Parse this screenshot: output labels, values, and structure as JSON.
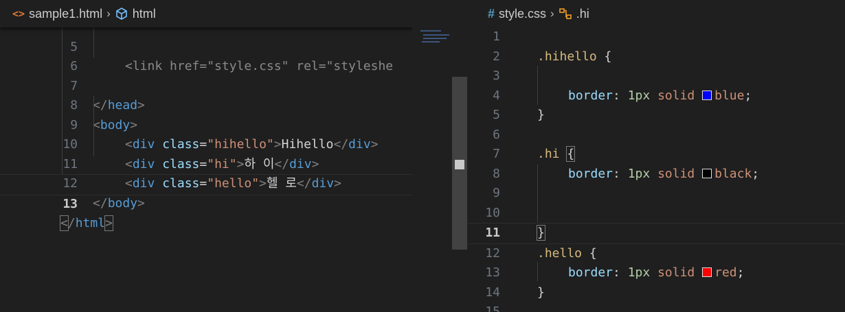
{
  "colors": {
    "blue": "#0000ff",
    "black": "#000000",
    "red": "#ff0000"
  },
  "left_editor": {
    "breadcrumb": {
      "file": "sample1.html",
      "symbol": "html",
      "file_icon": "code-icon",
      "symbol_icon": "cube-icon"
    },
    "lines": [
      {
        "n": "5",
        "partial": "<link href=\"style.css\" rel=\"styleshe"
      },
      {
        "n": "6"
      },
      {
        "n": "7",
        "tag": "head",
        "closing": true
      },
      {
        "n": "8",
        "tag": "body"
      },
      {
        "n": "9",
        "tag": "div",
        "attr": "class",
        "value": "\"hihello\"",
        "content": "Hihello"
      },
      {
        "n": "10",
        "tag": "div",
        "attr": "class",
        "value": "\"hi\"",
        "content": "하 이"
      },
      {
        "n": "11",
        "tag": "div",
        "attr": "class",
        "value": "\"hello\"",
        "content": "헬 로"
      },
      {
        "n": "12",
        "tag": "body",
        "closing": true
      },
      {
        "n": "13",
        "tag": "html",
        "closing": true
      }
    ]
  },
  "right_editor": {
    "breadcrumb": {
      "file": "style.css",
      "symbol": ".hi",
      "file_icon": "hash-icon",
      "symbol_icon": "selector-icon"
    },
    "lines": [
      {
        "n": "1"
      },
      {
        "n": "2",
        "selector": ".hihello"
      },
      {
        "n": "3"
      },
      {
        "n": "4",
        "prop": "border",
        "num": "1px",
        "style": "solid",
        "color": "blue"
      },
      {
        "n": "5"
      },
      {
        "n": "6"
      },
      {
        "n": "7",
        "selector": ".hi"
      },
      {
        "n": "8",
        "prop": "border",
        "num": "1px",
        "style": "solid",
        "color": "black"
      },
      {
        "n": "9"
      },
      {
        "n": "10"
      },
      {
        "n": "11"
      },
      {
        "n": "12",
        "selector": ".hello"
      },
      {
        "n": "13",
        "prop": "border",
        "num": "1px",
        "style": "solid",
        "color": "red"
      },
      {
        "n": "14"
      },
      {
        "n": "15"
      }
    ]
  }
}
